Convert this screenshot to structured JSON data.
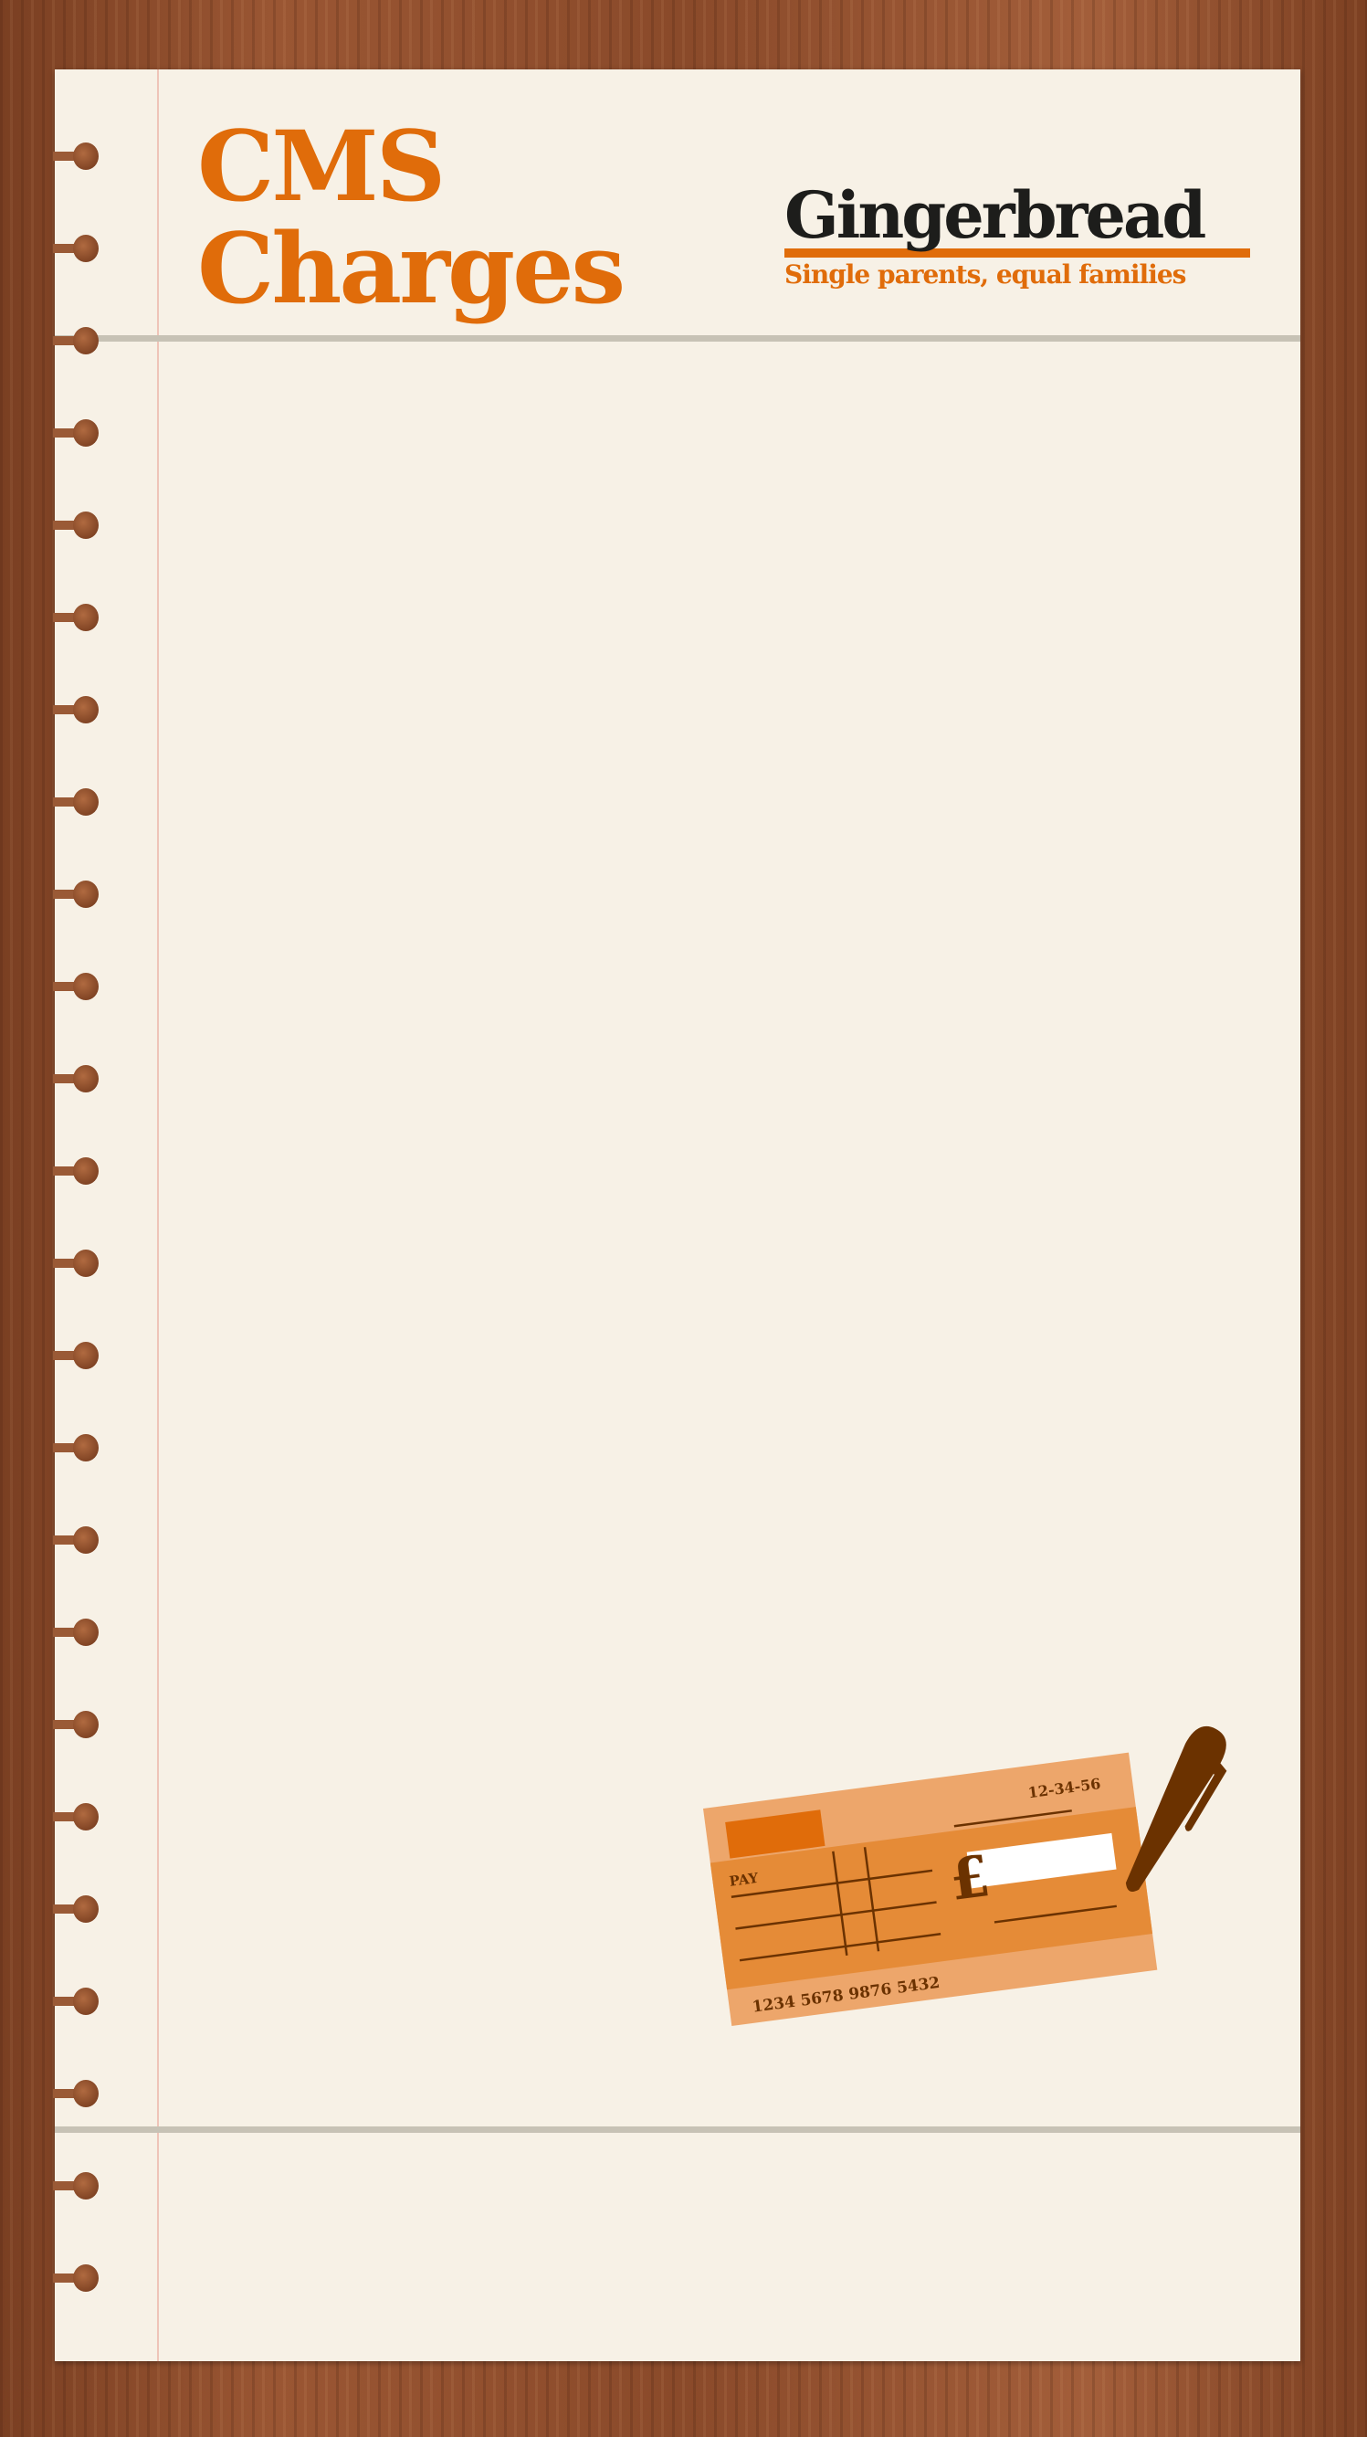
{
  "title": {
    "line1": "CMS",
    "line2": "Charges"
  },
  "logo": {
    "name": "Gingerbread",
    "tagline": "Single parents, equal families"
  },
  "cheque": {
    "sort_code": "12-34-56",
    "pay_label": "PAY",
    "currency_symbol": "£",
    "account_number": "1234 5678 9876 5432"
  },
  "colors": {
    "accent": "#e06c0a",
    "paper": "#f7f1e6",
    "cheque_light": "#eda66b",
    "cheque_mid": "#e58b37",
    "ink": "#6b3200"
  },
  "icons": [
    "spiral-binding-rings",
    "cheque-illustration",
    "pen-icon"
  ]
}
